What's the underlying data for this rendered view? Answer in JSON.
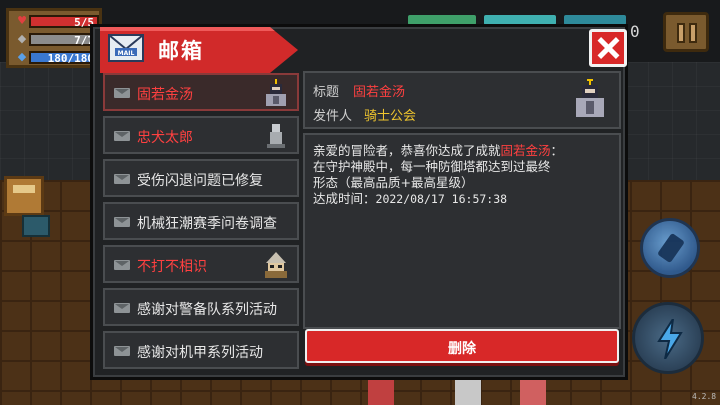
{
  "hud": {
    "health": "5/5",
    "armor": "7/7",
    "energy": "180/180",
    "counter": "0",
    "version": "4.2.8"
  },
  "mailbox": {
    "title": "邮箱",
    "mail_icon_text": "MAIL",
    "delete_label": "删除"
  },
  "mails": [
    {
      "subject": "固若金汤",
      "highlight": true,
      "selected": true,
      "thumb": "knight-avatar-icon"
    },
    {
      "subject": "忠犬太郎",
      "highlight": true,
      "selected": false,
      "thumb": "dog-statue-icon"
    },
    {
      "subject": "受伤闪退问题已修复",
      "highlight": false,
      "selected": false,
      "thumb": ""
    },
    {
      "subject": "机械狂潮赛季问卷调查",
      "highlight": false,
      "selected": false,
      "thumb": ""
    },
    {
      "subject": "不打不相识",
      "highlight": true,
      "selected": false,
      "thumb": "bandit-icon"
    },
    {
      "subject": "感谢对警备队系列活动",
      "highlight": false,
      "selected": false,
      "thumb": ""
    },
    {
      "subject": "感谢对机甲系列活动",
      "highlight": false,
      "selected": false,
      "thumb": ""
    }
  ],
  "detail": {
    "title_label": "标题",
    "title_value": "固若金汤",
    "sender_label": "发件人",
    "sender_value": "骑士公会",
    "body_intro": "亲爱的冒险者，恭喜你达成了成就",
    "body_achievement": "固若金汤",
    "body_colon": "：",
    "body_line2": "在守护神殿中，每一种防御塔都达到过最终",
    "body_line3": "形态（最高品质+最高星级）",
    "body_time_label": "达成时间：",
    "body_time_value": "2022/08/17 16:57:38"
  },
  "colors": {
    "accent_red": "#d82828",
    "highlight_text": "#ff4040",
    "sender_yellow": "#f0c62e",
    "panel_bg": "#202224"
  }
}
